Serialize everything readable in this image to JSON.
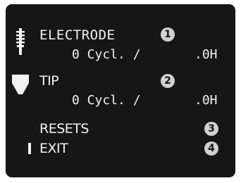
{
  "menu": {
    "electrode": {
      "label": "ELECTRODE",
      "cycles": "0 Cycl. /",
      "hours": ".0H",
      "badge": "1",
      "icon": "electrode-icon"
    },
    "tip": {
      "label": "TIP",
      "cycles": "0 Cycl. /",
      "hours": ".0H",
      "badge": "2",
      "icon": "tip-icon"
    },
    "resets": {
      "label": "RESETS",
      "badge": "3"
    },
    "exit": {
      "label": "EXIT",
      "badge": "4"
    }
  },
  "colors": {
    "screen_background": "#161616",
    "text": "#f2f2f2",
    "badge": "#d0d0d0"
  }
}
